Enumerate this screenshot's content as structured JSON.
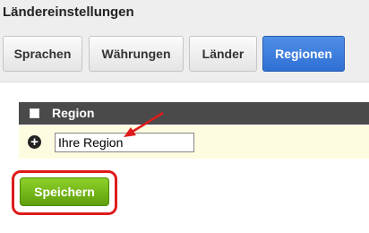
{
  "page": {
    "title": "Ländereinstellungen"
  },
  "tabs": [
    {
      "label": "Sprachen",
      "active": false
    },
    {
      "label": "Währungen",
      "active": false
    },
    {
      "label": "Länder",
      "active": false
    },
    {
      "label": "Regionen",
      "active": true
    }
  ],
  "table": {
    "header": {
      "label": "Region"
    },
    "new_row": {
      "add_icon": "plus-circle-icon",
      "input_value": "Ihre Region"
    }
  },
  "actions": {
    "save_label": "Speichern"
  },
  "annotations": {
    "color": "#e01b1b"
  },
  "colors": {
    "active_tab": "#3a7bd5",
    "save_button": "#6aaa14",
    "row_highlight": "#fefce0"
  }
}
